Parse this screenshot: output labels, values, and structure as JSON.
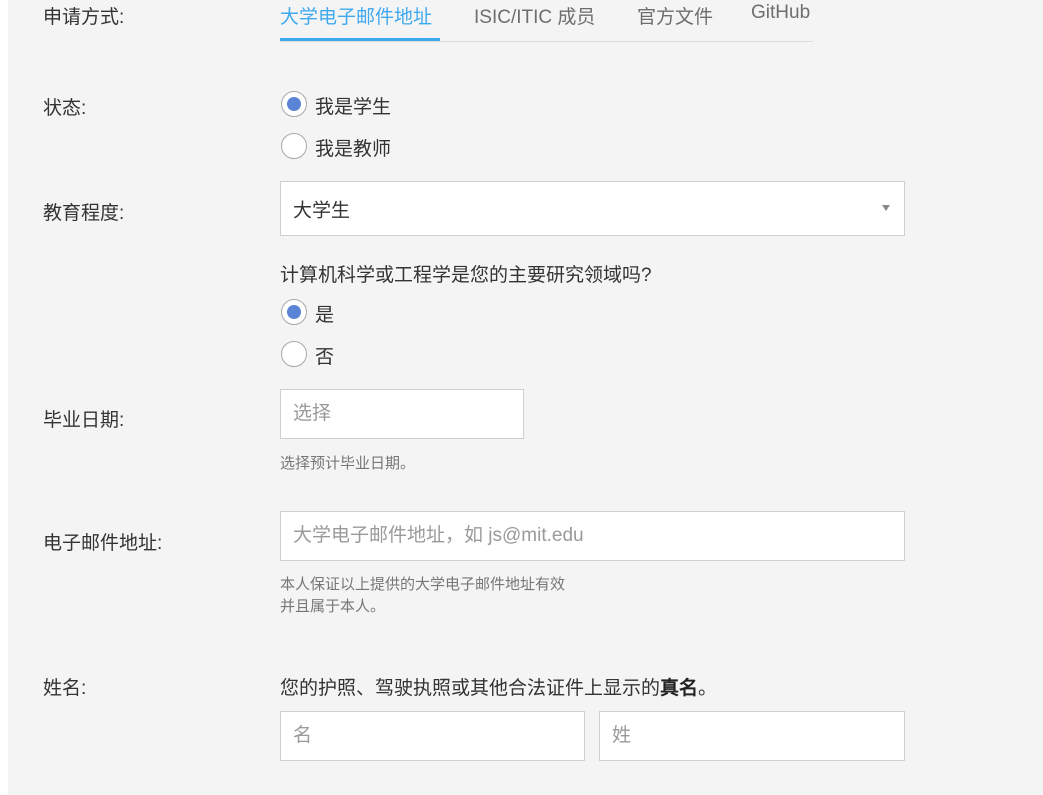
{
  "labels": {
    "method": "申请方式:",
    "status": "状态:",
    "education": "教育程度:",
    "graduation": "毕业日期:",
    "email": "电子邮件地址:",
    "name": "姓名:"
  },
  "tabs": [
    {
      "label": "大学电子邮件地址",
      "active": true
    },
    {
      "label": "ISIC/ITIC 成员",
      "active": false
    },
    {
      "label": "官方文件",
      "active": false
    },
    {
      "label": "GitHub",
      "active": false
    }
  ],
  "status_options": [
    {
      "label": "我是学生",
      "selected": true
    },
    {
      "label": "我是教师",
      "selected": false
    }
  ],
  "education": {
    "selected": "大学生"
  },
  "cs_question": {
    "text": "计算机科学或工程学是您的主要研究领域吗?",
    "options": [
      {
        "label": "是",
        "selected": true
      },
      {
        "label": "否",
        "selected": false
      }
    ]
  },
  "graduation": {
    "placeholder": "选择",
    "help": "选择预计毕业日期。"
  },
  "email": {
    "placeholder": "大学电子邮件地址，如 js@mit.edu",
    "help_line1": "本人保证以上提供的大学电子邮件地址有效",
    "help_line2": "并且属于本人。"
  },
  "name": {
    "description_prefix": "您的护照、驾驶执照或其他合法证件上显示的",
    "description_bold": "真名",
    "description_suffix": "。",
    "first_placeholder": "名",
    "last_placeholder": "姓"
  },
  "colors": {
    "accent": "#3fa9f0",
    "radio_selected": "#5b84d6",
    "background": "#f4f4f4"
  }
}
